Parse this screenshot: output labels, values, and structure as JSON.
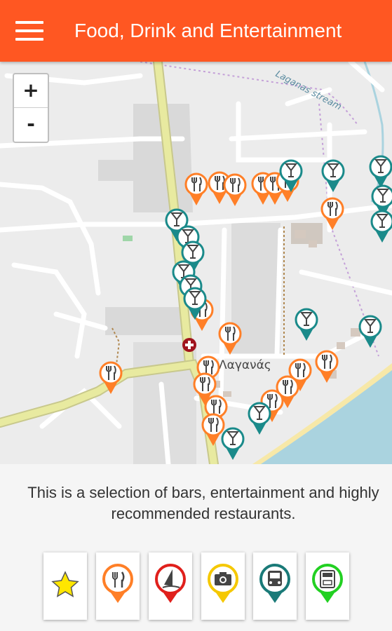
{
  "appbar": {
    "title": "Food, Drink and Entertainment",
    "menu_icon": "hamburger-menu-icon",
    "color": "#ff5722"
  },
  "map": {
    "zoom_in_label": "+",
    "zoom_out_label": "-",
    "place_label": "Λαγανάς",
    "stream_label": "Laganas stream",
    "colors": {
      "food_pin": "#ff7f27",
      "bar_pin": "#1a8a8a",
      "road_major": "#e8eaa0",
      "sea": "#aad3df",
      "beach": "#f7e8a8",
      "hospital": "#a0141e"
    }
  },
  "description": {
    "text": "This is a selection of bars, entertainment and highly recommended restaurants."
  },
  "categories": [
    {
      "icon": "star-icon",
      "color": "#ffe600"
    },
    {
      "icon": "fork-knife-pin-icon",
      "color": "#ff7f27"
    },
    {
      "icon": "windsurf-pin-icon",
      "color": "#e0201c"
    },
    {
      "icon": "camera-pin-icon",
      "color": "#f5c800"
    },
    {
      "icon": "bus-pin-icon",
      "color": "#1a7a78"
    },
    {
      "icon": "atm-pin-icon",
      "color": "#22d022"
    }
  ]
}
